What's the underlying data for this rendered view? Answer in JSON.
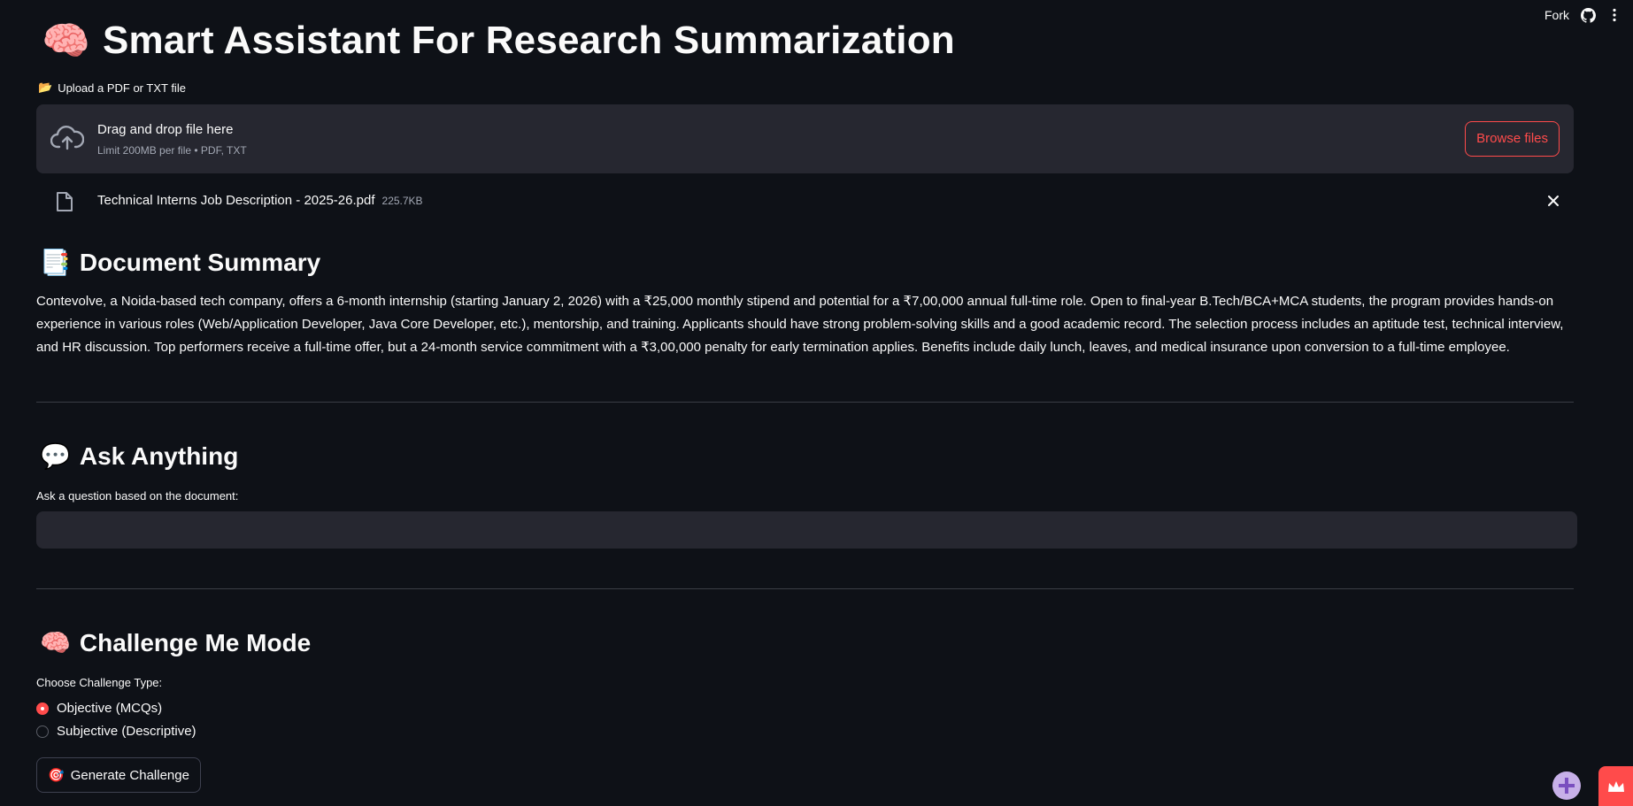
{
  "topbar": {
    "fork_label": "Fork",
    "github_icon": "github-icon",
    "menu_icon": "kebab-menu-icon"
  },
  "header": {
    "icon": "🧠",
    "title": "Smart Assistant For Research Summarization"
  },
  "upload": {
    "label_icon": "📂",
    "label": "Upload a PDF or TXT file",
    "dropzone_title": "Drag and drop file here",
    "dropzone_hint": "Limit 200MB per file • PDF, TXT",
    "browse_label": "Browse files",
    "file": {
      "name": "Technical Interns Job Description - 2025-26.pdf",
      "size": "225.7KB"
    }
  },
  "summary": {
    "icon": "📑",
    "title": "Document Summary",
    "text": "Contevolve, a Noida-based tech company, offers a 6-month internship (starting January 2, 2026) with a ₹25,000 monthly stipend and potential for a ₹7,00,000 annual full-time role. Open to final-year B.Tech/BCA+MCA students, the program provides hands-on experience in various roles (Web/Application Developer, Java Core Developer, etc.), mentorship, and training. Applicants should have strong problem-solving skills and a good academic record. The selection process includes an aptitude test, technical interview, and HR discussion. Top performers receive a full-time offer, but a 24-month service commitment with a ₹3,00,000 penalty for early termination applies. Benefits include daily lunch, leaves, and medical insurance upon conversion to a full-time employee."
  },
  "ask": {
    "icon": "💬",
    "title": "Ask Anything",
    "input_label": "Ask a question based on the document:",
    "input_value": ""
  },
  "challenge": {
    "icon": "🧠",
    "title": "Challenge Me Mode",
    "choose_label": "Choose Challenge Type:",
    "options": [
      {
        "label": "Objective (MCQs)",
        "selected": true
      },
      {
        "label": "Subjective (Descriptive)",
        "selected": false
      }
    ],
    "button_icon": "🎯",
    "button_label": "Generate Challenge"
  },
  "colors": {
    "background": "#0e1117",
    "panel": "#262730",
    "accent": "#ff4b4b",
    "text": "#fafafa"
  }
}
